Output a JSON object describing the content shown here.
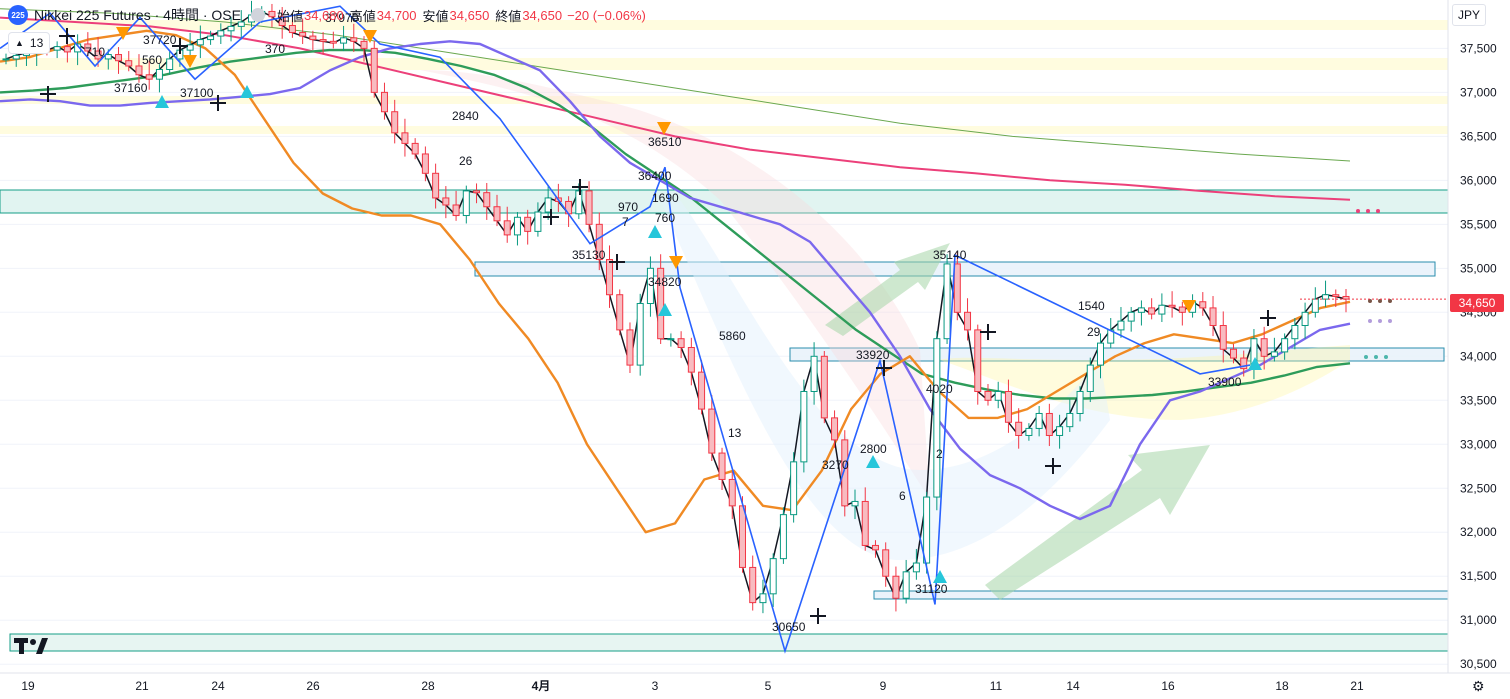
{
  "header": {
    "logo_text": "225",
    "symbol": "Nikkei 225 Futures · 4時間 · OSE",
    "open_label": "始値",
    "open_value": "34,680",
    "high_label": "高値",
    "high_value": "34,700",
    "low_label": "安値",
    "low_value": "34,650",
    "close_label": "終値",
    "close_value": "34,650",
    "change": "−20 (−0.06%)"
  },
  "indicator_count": "13",
  "currency": "JPY",
  "last_price_tag": "34,650",
  "colors": {
    "up": "#089981",
    "down": "#f23645",
    "accent": "#2962ff"
  },
  "icons": {
    "settings": "gear-icon",
    "logo": "tradingview-logo"
  },
  "chart_data": {
    "type": "candlestick",
    "y_axis": {
      "min": 30400,
      "max": 38050,
      "ticks": [
        "37,500",
        "37,000",
        "36,500",
        "36,000",
        "35,500",
        "35,000",
        "34,500",
        "34,000",
        "33,500",
        "33,000",
        "32,500",
        "32,000",
        "31,500",
        "31,000",
        "30,500"
      ]
    },
    "x_axis": {
      "labels": [
        "19",
        "21",
        "24",
        "26",
        "28",
        "4月",
        "3",
        "5",
        "9",
        "11",
        "14",
        "16",
        "18",
        "21"
      ]
    },
    "annotations": [
      "37970",
      "37720",
      "710",
      "560",
      "370",
      "37160",
      "37100",
      "2840",
      "26",
      "36510",
      "36400",
      "1690",
      "970",
      "7",
      "760",
      "35130",
      "34820",
      "5860",
      "13",
      "30650",
      "33920",
      "3270",
      "2800",
      "6",
      "31120",
      "4020",
      "2",
      "35140",
      "1540",
      "29",
      "33900"
    ],
    "markers_down": [
      [
        0,
        0
      ]
    ],
    "closes": [
      37380,
      37420,
      37450,
      37500,
      37480,
      37520,
      37460,
      37550,
      37470,
      37380,
      37430,
      37360,
      37300,
      37200,
      37150,
      37260,
      37380,
      37480,
      37540,
      37600,
      37640,
      37700,
      37750,
      37800,
      37880,
      37920,
      37860,
      37760,
      37680,
      37640,
      37600,
      37580,
      37560,
      37620,
      37580,
      37500,
      37000,
      36780,
      36540,
      36420,
      36300,
      36080,
      35800,
      35720,
      35600,
      35880,
      35860,
      35700,
      35540,
      35380,
      35580,
      35420,
      35640,
      35800,
      35760,
      35620,
      35880,
      35500,
      35100,
      34700,
      34300,
      33900,
      34600,
      35000,
      34200,
      34200,
      34100,
      33820,
      33400,
      32900,
      32600,
      32300,
      31600,
      31200,
      31300,
      31700,
      32200,
      32800,
      33600,
      34000,
      33300,
      33050,
      32300,
      32350,
      31850,
      31800,
      31500,
      31250,
      31550,
      31650,
      32400,
      34200,
      35050,
      34500,
      34300,
      33600,
      33500,
      33600,
      33250,
      33100,
      33180,
      33350,
      33100,
      33200,
      33350,
      33600,
      33900,
      34150,
      34300,
      34400,
      34500,
      34550,
      34480,
      34580,
      34560,
      34500,
      34620,
      34550,
      34350,
      34080,
      33980,
      33860,
      34200,
      34000,
      34050,
      34200,
      34350,
      34500,
      34650,
      34700,
      34680,
      34650
    ],
    "sma_blue": [
      36900,
      36920,
      36900,
      36850,
      36850,
      36880,
      36900,
      36920,
      36950,
      36980,
      37050,
      37250,
      37400,
      37500,
      37550,
      37580,
      37550,
      37400,
      37250,
      36900,
      36500,
      36200,
      36000,
      35800,
      35700,
      35600,
      35500,
      35300,
      34900,
      34500,
      34000,
      33400,
      32950,
      32650,
      32500,
      32300,
      32150,
      32300,
      33000,
      33500,
      33600,
      33750,
      33900,
      34100,
      34300,
      34370
    ],
    "ema_green": [
      37000,
      37020,
      37050,
      37100,
      37150,
      37200,
      37280,
      37350,
      37400,
      37450,
      37480,
      37480,
      37450,
      37380,
      37300,
      37200,
      37050,
      36850,
      36600,
      36300,
      36050,
      35800,
      35500,
      35200,
      34900,
      34600,
      34300,
      34050,
      33800,
      33700,
      33620,
      33560,
      33520,
      33520,
      33540,
      33560,
      33600,
      33650,
      33700,
      33780,
      33880,
      33920
    ],
    "ema_orange": [
      37350,
      37400,
      37500,
      37600,
      37650,
      37700,
      37650,
      37500,
      37200,
      36700,
      36200,
      35850,
      35680,
      35600,
      35600,
      35500,
      35100,
      34600,
      34200,
      33700,
      33000,
      32500,
      32000,
      32100,
      32600,
      32700,
      32300,
      32250,
      32700,
      33400,
      33800,
      34000,
      33600,
      33300,
      33300,
      33400,
      33600,
      33800,
      34000,
      34150,
      34250,
      34200,
      34150,
      34250,
      34400,
      34550,
      34620
    ],
    "sma_red": [
      37850,
      37800,
      37750,
      37650,
      37500,
      37300,
      37100,
      36900,
      36700,
      36500,
      36350,
      36250,
      36150,
      36080,
      36000,
      35950,
      35880,
      35820,
      35780
    ],
    "sma_olive": [
      37950,
      37900,
      37800,
      37650,
      37450,
      37250,
      37050,
      36850,
      36650,
      36500,
      36400,
      36300,
      36220
    ]
  }
}
